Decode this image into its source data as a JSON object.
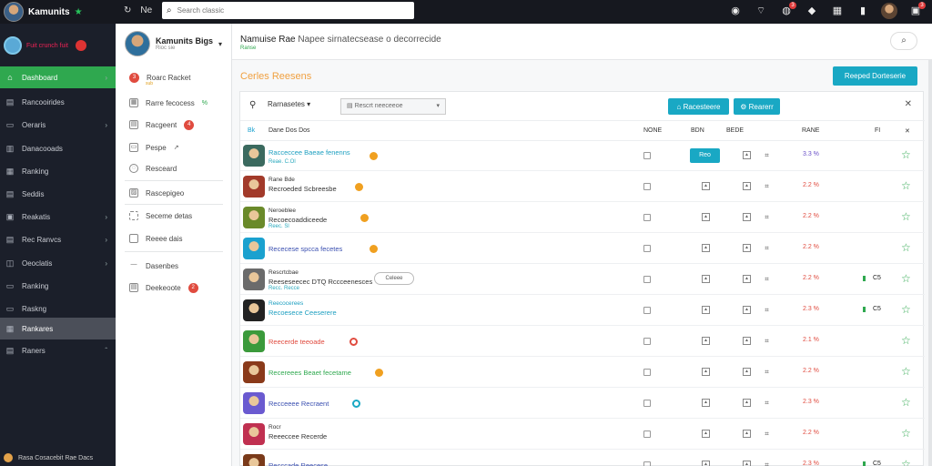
{
  "topbar": {
    "brand": "Kamunits",
    "back_icon": "back-arrow-icon",
    "nav_label": "Ne",
    "search_placeholder": "Search classic",
    "notification_count": "3",
    "alert_count": "3"
  },
  "sidebar": {
    "profile_text": "Fuit crunch fuit",
    "items": [
      {
        "label": "Dashboard",
        "icon": "home-icon",
        "active": true
      },
      {
        "label": "Rancooirides",
        "icon": "grid-icon"
      },
      {
        "label": "Oeraris",
        "icon": "folder-icon"
      },
      {
        "label": "Danacooads",
        "icon": "list-icon"
      },
      {
        "label": "Ranking",
        "icon": "chart-icon"
      },
      {
        "label": "Seddis",
        "icon": "calendar-icon"
      },
      {
        "label": "Reakatis",
        "icon": "doc-icon"
      },
      {
        "label": "Rec Ranvcs",
        "icon": "tag-icon"
      },
      {
        "label": "Oeoclatis",
        "icon": "layers-icon"
      },
      {
        "label": "Ranking",
        "icon": "trophy-icon"
      },
      {
        "label": "Raskng",
        "icon": "box-icon"
      },
      {
        "label": "Rankares",
        "icon": "users-icon",
        "selected": true
      },
      {
        "label": "Raners",
        "icon": "settings-icon"
      }
    ],
    "footer": "Rasa Cosacebit Rae Dacs"
  },
  "panel2": {
    "name": "Kamunits Bigs",
    "sub": "Rioc sie",
    "items": [
      {
        "label": "Roarc Racket",
        "sub": "sub",
        "num": "3"
      },
      {
        "label": "Rarre fecocess",
        "extra": "%"
      },
      {
        "label": "Racgeent",
        "num": "4"
      },
      {
        "label": "Pespe",
        "extra": "↗"
      },
      {
        "label": "Resceard"
      },
      {
        "label": "Rascepigeo"
      },
      {
        "label": "Seceme detas"
      },
      {
        "label": "Reeee dais"
      },
      {
        "label": "Dasenbes"
      },
      {
        "label": "Deekeoote",
        "num": "2"
      }
    ]
  },
  "main": {
    "title": "Namuise Rae",
    "title_light": "Napee sirnatecsease o decorrecide",
    "subtitle": "Ranse",
    "section_title": "Cerles Reesens",
    "top_button": "Reeped Dorteserie",
    "tool_label": "Rarnasetes",
    "tool_select": "Rescrt neeceeoe",
    "tool_btn1": "Racesteere",
    "tool_btn2": "Rearerr",
    "columns": {
      "c1": "Bk",
      "c2": "Dane Dos Dos",
      "c3": "NONE",
      "c4": "BDN",
      "c5": "BEDE",
      "c6": "RANE",
      "c7": "FI"
    }
  },
  "rows": [
    {
      "name": "Racceccee Baeae fenenns",
      "sub": "Reae. C.Ol",
      "name_color": "#1d9fc0",
      "badge": true,
      "icon_color": "#3b6a5f",
      "cell_button": "Reo",
      "pct": "3.3 %",
      "pct_color": "#6a50c8"
    },
    {
      "name": "Rane Bde",
      "name2": "Recroeded Scbreesbe",
      "name_color": "#333",
      "badge": true,
      "icon_color": "#a23a2a",
      "pct": "2.2 %",
      "pct_color": "#e04b3f"
    },
    {
      "name": "Neroeblee",
      "name2": "Recoecoaddiceede",
      "sub": "Reec. Sl",
      "name_color": "#333",
      "badge": true,
      "icon_color": "#6a8a2a",
      "pct": "2.2 %",
      "pct_color": "#e04b3f"
    },
    {
      "name": "Rececese spcca fecetes",
      "name_color": "#3a4fb0",
      "badge": true,
      "icon_color": "#1aa1cf",
      "pct": "2.2 %",
      "pct_color": "#e04b3f"
    },
    {
      "name": "Rescrtcbae",
      "name2": "Reeseseecec DTQ Rccceenesces",
      "sub": "Recc. Recce",
      "name_color": "#333",
      "pill": "Celeee",
      "icon_color": "#6b6b6b",
      "pct": "2.2 %",
      "pct_color": "#e04b3f",
      "extra": "C5"
    },
    {
      "name": "Reecocerees",
      "name2": "Recoesece Ceeserere",
      "name_color": "#1d9fc0",
      "icon_color": "#222",
      "pct": "2.3 %",
      "pct_color": "#e04b3f",
      "extra": "C5"
    },
    {
      "name": "Reecerde teeoade",
      "name_color": "#e04b3f",
      "badge_red": true,
      "icon_color": "#3b9a3b",
      "pct": "2.1 %",
      "pct_color": "#e04b3f"
    },
    {
      "name": "Recereees Beaet fecetame",
      "name_color": "#2fa84f",
      "badge": true,
      "icon_color": "#8a3a1a",
      "pct": "2.2 %",
      "pct_color": "#e04b3f"
    },
    {
      "name": "Recceeee Recraent",
      "name_color": "#3a4fb0",
      "badge_teal": true,
      "icon_color": "#6a5ad0",
      "pct": "2.3 %",
      "pct_color": "#e04b3f"
    },
    {
      "name": "Rocr",
      "name2": "Reeeccee Recerde",
      "name_color": "#333",
      "icon_color": "#c03050",
      "pct": "2.2 %",
      "pct_color": "#e04b3f"
    },
    {
      "name": "Recccade Reecese",
      "name_color": "#3a4fb0",
      "icon_color": "#7a3a1a",
      "pct": "2.3 %",
      "pct_color": "#e04b3f",
      "extra": "C5"
    }
  ]
}
